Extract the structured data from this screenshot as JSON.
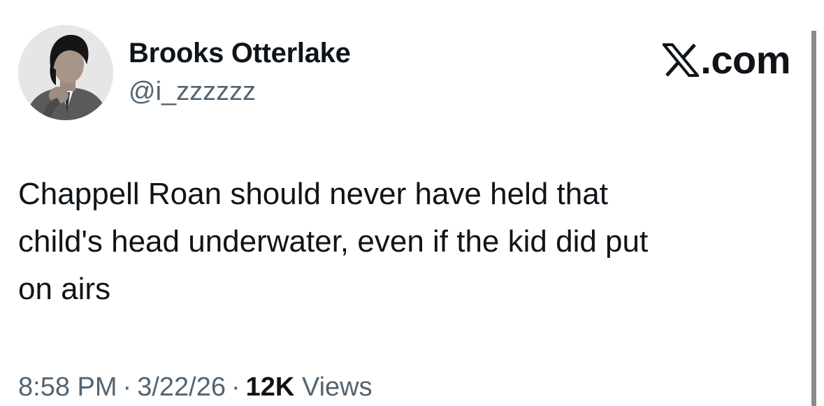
{
  "author": {
    "display_name": "Brooks Otterlake",
    "handle": "@i_zzzzzz"
  },
  "brand": {
    "icon": "x-logo-icon",
    "text": ".com"
  },
  "tweet": {
    "text": "Chappell Roan should never have held that\nchild's head underwater, even if the kid did put\non airs"
  },
  "meta": {
    "time": "8:58 PM",
    "separator": "·",
    "date": "3/22/26",
    "views_count": "12K",
    "views_label": "Views"
  }
}
